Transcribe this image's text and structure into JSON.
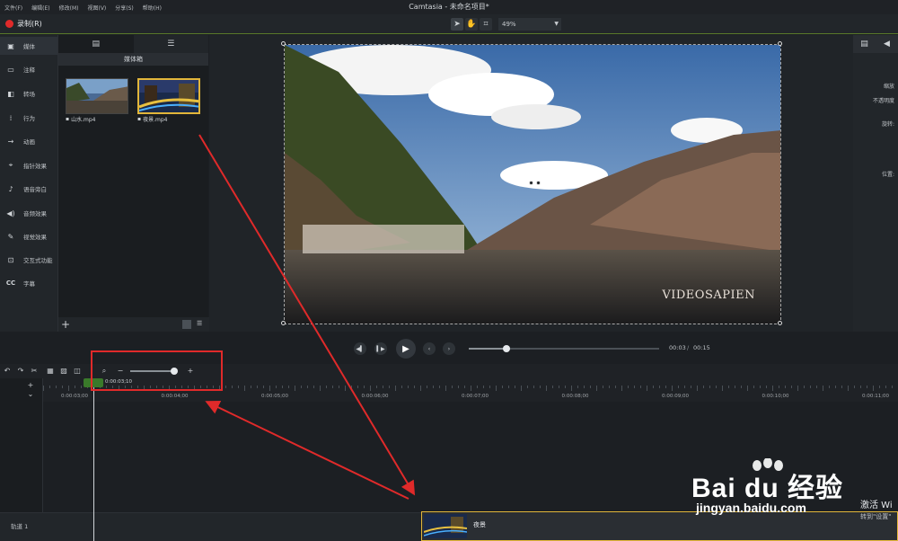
{
  "menubar": {
    "items": [
      "文件(F)",
      "编辑(E)",
      "修改(M)",
      "视图(V)",
      "分享(S)",
      "帮助(H)"
    ],
    "title": "Camtasia - 未命名项目*"
  },
  "toolbar": {
    "record_label": "录制(R)",
    "tools": [
      "pointer-icon",
      "hand-icon",
      "crop-icon"
    ],
    "zoom_value": "49%"
  },
  "sidebar": {
    "items": [
      {
        "icon": "media-icon",
        "label": "媒体"
      },
      {
        "icon": "annotation-icon",
        "label": "注释"
      },
      {
        "icon": "transition-icon",
        "label": "转场"
      },
      {
        "icon": "behavior-icon",
        "label": "行为"
      },
      {
        "icon": "animation-icon",
        "label": "动画"
      },
      {
        "icon": "cursor-effect-icon",
        "label": "指针效果"
      },
      {
        "icon": "voice-narration-icon",
        "label": "语音旁白"
      },
      {
        "icon": "audio-effect-icon",
        "label": "音频效果"
      },
      {
        "icon": "visual-effect-icon",
        "label": "视觉效果"
      },
      {
        "icon": "interactive-icon",
        "label": "交互式功能"
      },
      {
        "icon": "captions-icon",
        "label": "字幕"
      }
    ]
  },
  "bin": {
    "title": "媒体箱",
    "clips": [
      {
        "label": "山水.mp4"
      },
      {
        "label": "夜景.mp4"
      }
    ]
  },
  "properties": {
    "labels": [
      "缩放",
      "不透明度",
      "旋转:",
      "位置:"
    ]
  },
  "playback": {
    "current_time": "00:03",
    "separator": "/",
    "total_time": "00:15",
    "progress": 0.2
  },
  "timeline": {
    "playhead_time": "0:00:03;10",
    "ruler_labels": [
      "0:00:03;00",
      "0:00:04;00",
      "0:00:05;00",
      "0:00:06;00",
      "0:00:07;00",
      "0:00:08;00",
      "0:00:09;00",
      "0:00:10;00",
      "0:00:11;00"
    ],
    "track_label": "轨道 1",
    "clip_label": "夜景"
  },
  "video": {
    "watermark": "VIDEOSAPIEN"
  },
  "overlay": {
    "baidu_main": "Bai du 经验",
    "baidu_sub": "jingyan.baidu.com",
    "activate_main": "激活 Wi",
    "activate_sub": "转到\"设置\""
  }
}
